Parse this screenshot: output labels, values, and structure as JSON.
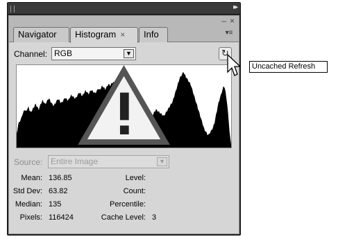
{
  "tabs": [
    {
      "label": "Navigator"
    },
    {
      "label": "Histogram"
    },
    {
      "label": "Info"
    }
  ],
  "tab_close_glyph": "×",
  "channel": {
    "label": "Channel:",
    "value": "RGB"
  },
  "source": {
    "label": "Source:",
    "value": "Entire Image"
  },
  "stats_left": {
    "mean_label": "Mean:",
    "mean": "136.85",
    "stddev_label": "Std Dev:",
    "stddev": "63.82",
    "median_label": "Median:",
    "median": "135",
    "pixels_label": "Pixels:",
    "pixels": "116424"
  },
  "stats_right": {
    "level_label": "Level:",
    "level": "",
    "count_label": "Count:",
    "count": "",
    "percentile_label": "Percentile:",
    "percentile": "",
    "cache_label": "Cache Level:",
    "cache": "3"
  },
  "tooltip": "Uncached Refresh",
  "icons": {
    "refresh": "refresh-icon",
    "warning": "warning-icon",
    "menu": "panel-menu-icon",
    "close": "close-icon",
    "collapse": "collapse-icon"
  },
  "histogram_data": [
    20,
    28,
    35,
    38,
    40,
    42,
    45,
    50,
    52,
    55,
    58,
    56,
    55,
    58,
    60,
    62,
    58,
    55,
    54,
    56,
    58,
    60,
    62,
    65,
    66,
    64,
    62,
    60,
    58,
    62,
    65,
    68,
    70,
    72,
    70,
    68,
    66,
    68,
    70,
    72,
    74,
    75,
    72,
    70,
    68,
    66,
    65,
    64,
    66,
    68,
    70,
    72,
    74,
    73,
    72,
    70,
    68,
    69,
    70,
    72,
    74,
    76,
    75,
    74,
    73,
    72,
    74,
    76,
    78,
    80,
    79,
    78,
    77,
    76,
    75,
    76,
    78,
    80,
    82,
    84,
    83,
    82,
    80,
    79,
    81,
    83,
    85,
    87,
    86,
    84,
    83,
    82,
    84,
    86,
    88,
    87,
    86,
    85,
    84,
    83,
    84,
    86,
    88,
    90,
    89,
    88,
    90,
    92,
    94,
    93,
    92,
    90,
    89,
    91,
    93,
    95,
    97,
    96,
    95,
    96,
    98,
    99,
    100,
    99,
    98,
    97,
    95,
    93,
    90,
    88,
    86,
    84,
    82,
    80,
    78,
    76,
    74,
    72,
    70,
    68,
    66,
    65,
    64,
    63,
    62,
    61,
    60,
    59,
    58,
    57,
    56,
    55,
    54,
    53,
    52,
    52,
    51,
    50,
    50,
    49,
    50,
    51,
    52,
    53,
    52,
    51,
    50,
    49,
    48,
    47,
    47,
    48,
    50,
    52,
    54,
    56,
    58,
    57,
    56,
    55,
    54,
    53,
    52,
    51,
    50,
    49,
    48,
    50,
    52,
    54,
    56,
    58,
    60,
    62,
    64,
    66,
    68,
    70,
    74,
    78,
    82,
    86,
    90,
    94,
    98,
    102,
    106,
    108,
    110,
    112,
    114,
    116,
    112,
    110,
    108,
    106,
    104,
    102,
    100,
    98,
    96,
    92,
    88,
    84,
    80,
    76,
    72,
    68,
    64,
    60,
    56,
    52,
    48,
    44,
    40,
    36,
    32,
    28,
    26,
    24,
    22,
    20,
    19,
    20,
    22,
    24,
    26,
    28,
    30,
    34,
    38,
    44,
    50,
    56,
    62,
    68,
    72,
    76,
    80,
    84,
    88,
    92,
    94,
    90,
    84,
    76,
    66,
    54,
    40,
    24,
    12,
    6
  ]
}
